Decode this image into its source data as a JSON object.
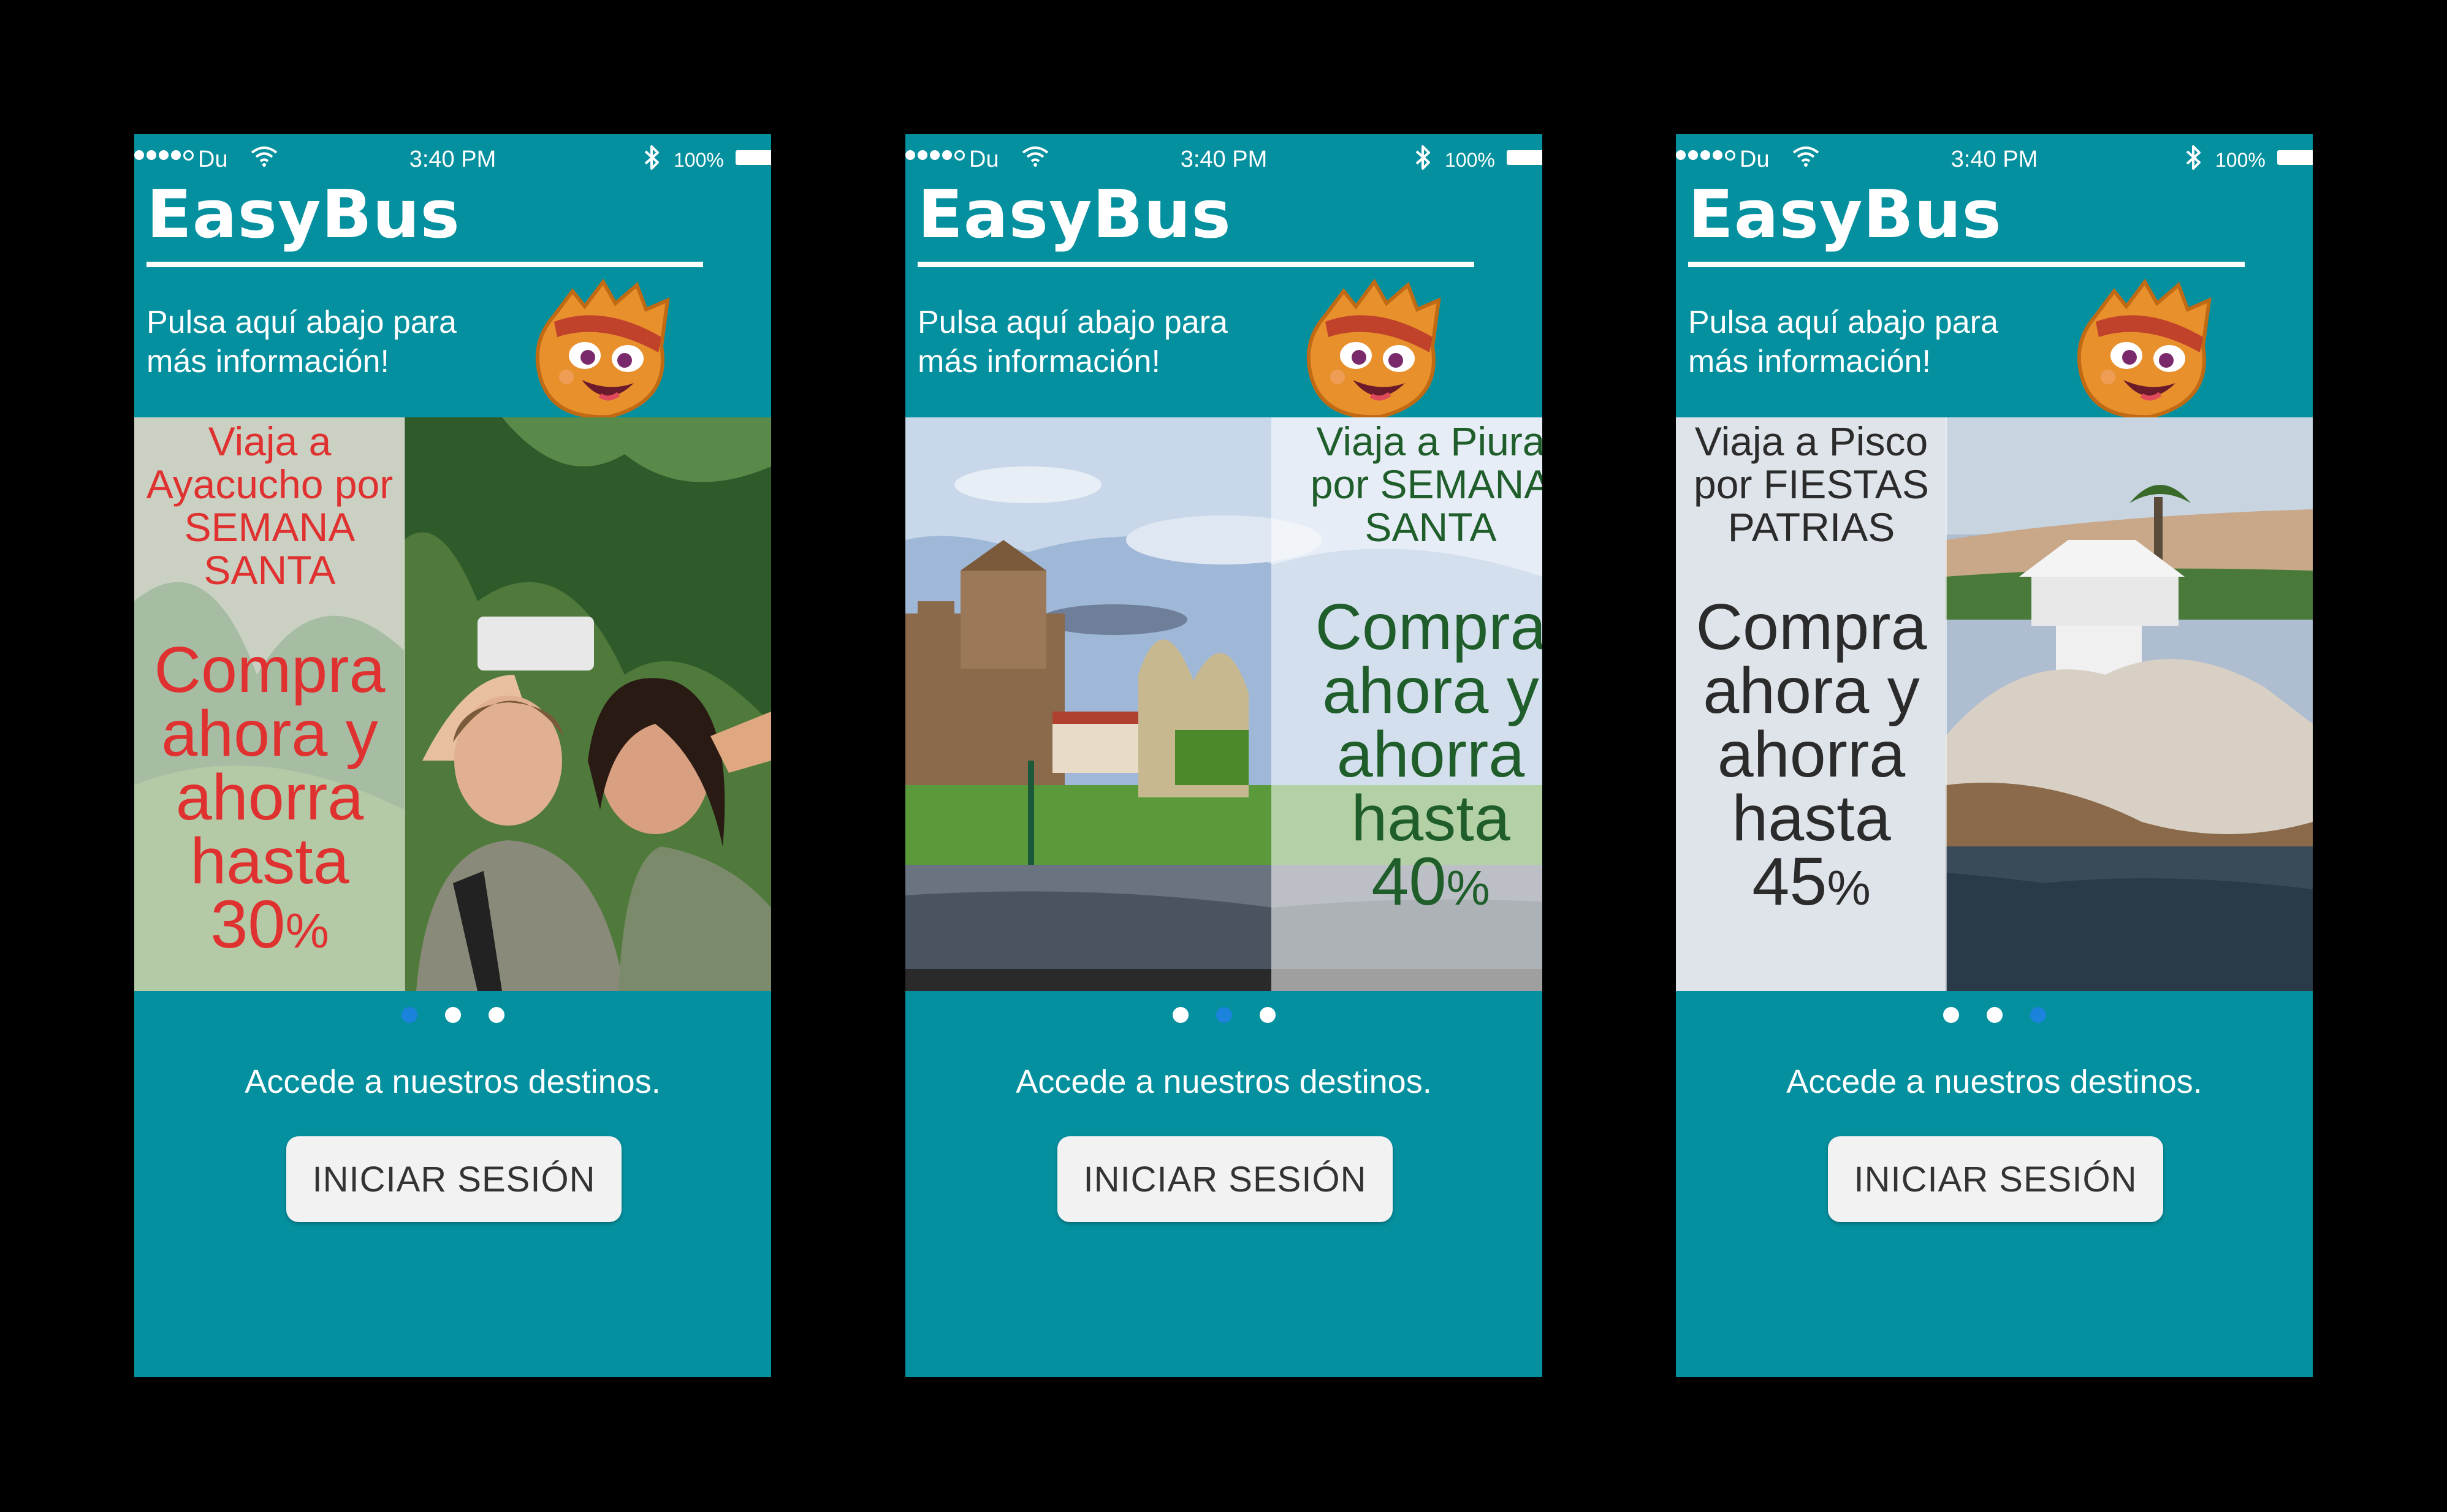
{
  "colors": {
    "app_background": "#05909f",
    "active_dot": "#1c83dc",
    "inactive_dot": "#ffffff",
    "button_background": "#f2f2f2"
  },
  "screens": [
    {
      "status": {
        "carrier": "Du",
        "time": "3:40 PM",
        "battery": "100%"
      },
      "app_title": "EasyBus",
      "info_line1": "Pulsa aquí abajo para",
      "info_line2": "más información!",
      "banner": {
        "headline_lines": [
          "Viaja a",
          "Ayacucho por",
          "SEMANA",
          "SANTA"
        ],
        "offer_lines": [
          "Compra",
          "ahora y",
          "ahorra",
          "hasta"
        ],
        "percent_value": "30",
        "percent_sign": "%",
        "text_color": "#e03131",
        "photo": "couple-selfie-mountains"
      },
      "active_page": 0,
      "access_text": "Accede a nuestros destinos.",
      "login_label": "INICIAR SESIÓN"
    },
    {
      "status": {
        "carrier": "Du",
        "time": "3:40 PM",
        "battery": "100%"
      },
      "app_title": "EasyBus",
      "info_line1": "Pulsa aquí abajo para",
      "info_line2": "más información!",
      "banner": {
        "headline_lines": [
          "Viaja a Piura",
          "por SEMANA",
          "SANTA"
        ],
        "offer_lines": [
          "Compra",
          "ahora y",
          "ahorra",
          "hasta"
        ],
        "percent_value": "40",
        "percent_sign": "%",
        "text_color": "#1f5e2b",
        "photo": "cathedral-plaza"
      },
      "active_page": 1,
      "access_text": "Accede a nuestros destinos.",
      "login_label": "INICIAR SESIÓN"
    },
    {
      "status": {
        "carrier": "Du",
        "time": "3:40 PM",
        "battery": "100%"
      },
      "app_title": "EasyBus",
      "info_line1": "Pulsa aquí abajo para",
      "info_line2": "más información!",
      "banner": {
        "headline_lines": [
          "Viaja a Pisco",
          "por FIESTAS",
          "PATRIAS"
        ],
        "offer_lines": [
          "Compra",
          "ahora y",
          "ahorra",
          "hasta"
        ],
        "percent_value": "45",
        "percent_sign": "%",
        "text_color": "#2b2b2b",
        "photo": "coastal-gazebo"
      },
      "active_page": 2,
      "access_text": "Accede a nuestros destinos.",
      "login_label": "INICIAR SESIÓN"
    }
  ]
}
